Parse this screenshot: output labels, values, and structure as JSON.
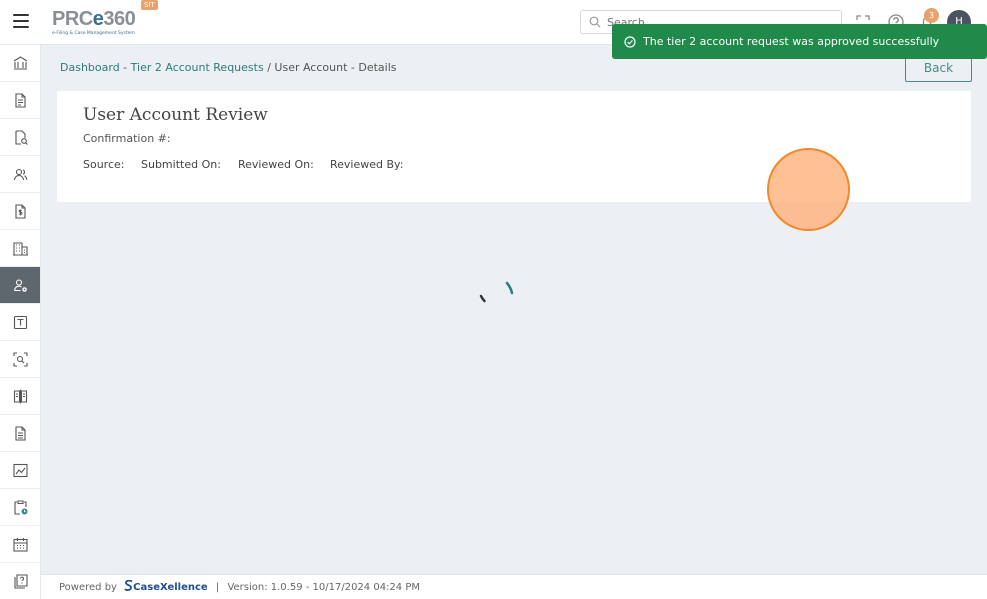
{
  "header": {
    "brand": "PRCe360",
    "brand_prefix": "PRC",
    "brand_e": "e",
    "brand_suffix": "360",
    "brand_tagline": "e-Filing & Case Management System",
    "env_badge": "SIT",
    "search_placeholder": "Search",
    "notification_count": "3",
    "avatar_initial": "H"
  },
  "sidebar": {
    "icons": [
      "bank-icon",
      "document-icon",
      "document-search-icon",
      "users-icon",
      "invoice-icon",
      "building-icon",
      "user-settings-icon",
      "template-icon",
      "scan-icon",
      "compare-icon",
      "document-list-icon",
      "chart-icon",
      "clipboard-clock-icon",
      "calendar-icon",
      "help-book-icon"
    ],
    "active_index": 6
  },
  "breadcrumb": {
    "dashboard": "Dashboard",
    "sep1": " - ",
    "requests": "Tier 2 Account Requests",
    "sep2": " / ",
    "current": "User Account - Details"
  },
  "back_label": "Back",
  "review": {
    "title": "User Account Review",
    "confirmation_label": "Confirmation #:",
    "source_label": "Source:",
    "submitted_label": "Submitted On:",
    "reviewed_on_label": "Reviewed On:",
    "reviewed_by_label": "Reviewed By:"
  },
  "toast": {
    "message": "The tier 2 account request was approved successfully"
  },
  "footer": {
    "powered_by": "Powered by",
    "company_prefix": "Case",
    "company_x": "X",
    "company_suffix": "ellence",
    "separator": "|",
    "version": "Version: 1.0.59 - 10/17/2024 04:24 PM"
  },
  "colors": {
    "accent": "#2e7a7a",
    "toast_bg": "#1f8a4a",
    "active_sidebar": "#5e666e",
    "badge": "#e8a26a"
  }
}
